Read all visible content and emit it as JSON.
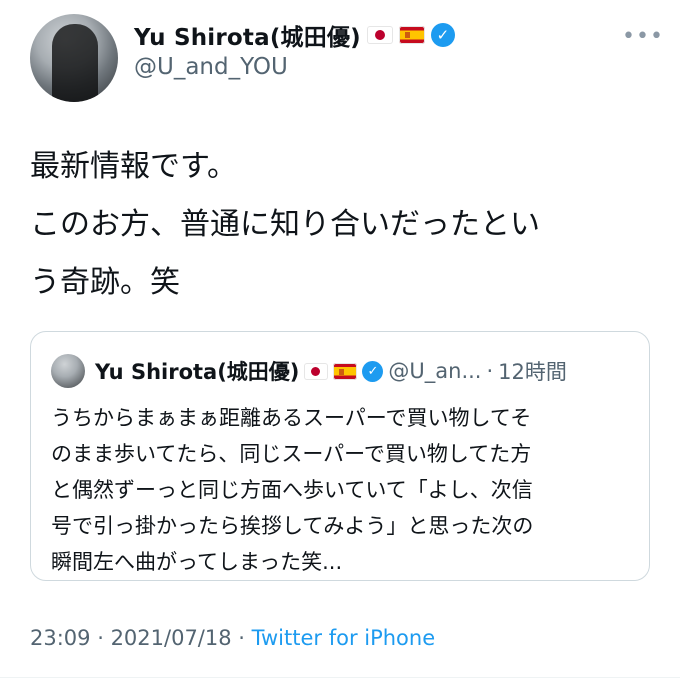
{
  "author": {
    "display_name": "Yu Shirota(城田優)",
    "handle": "@U_and_YOU",
    "flags": [
      "jp-flag",
      "es-flag"
    ],
    "verified_icon": "verified-badge-icon",
    "more_label": "•••"
  },
  "tweet": {
    "lines": [
      "最新情報です。",
      "このお方、普通に知り合いだったとい",
      "う奇跡。笑"
    ]
  },
  "quote": {
    "display_name": "Yu Shirota(城田優)",
    "handle": "@U_an...",
    "separator": "·",
    "time": "12時間",
    "lines": [
      "うちからまぁまぁ距離あるスーパーで買い物してそ",
      "のまま歩いてたら、同じスーパーで買い物してた方",
      "と偶然ずーっと同じ方面へ歩いていて「よし、次信",
      "号で引っ掛かったら挨拶してみよう」と思った次の",
      "瞬間左へ曲がってしまった笑..."
    ]
  },
  "meta": {
    "time": "23:09",
    "sep1": " · ",
    "date": "2021/07/18",
    "sep2": " · ",
    "source": "Twitter for iPhone"
  },
  "colors": {
    "accent": "#1d9bf0",
    "secondary_text": "#536471",
    "border": "#cfd9de"
  }
}
